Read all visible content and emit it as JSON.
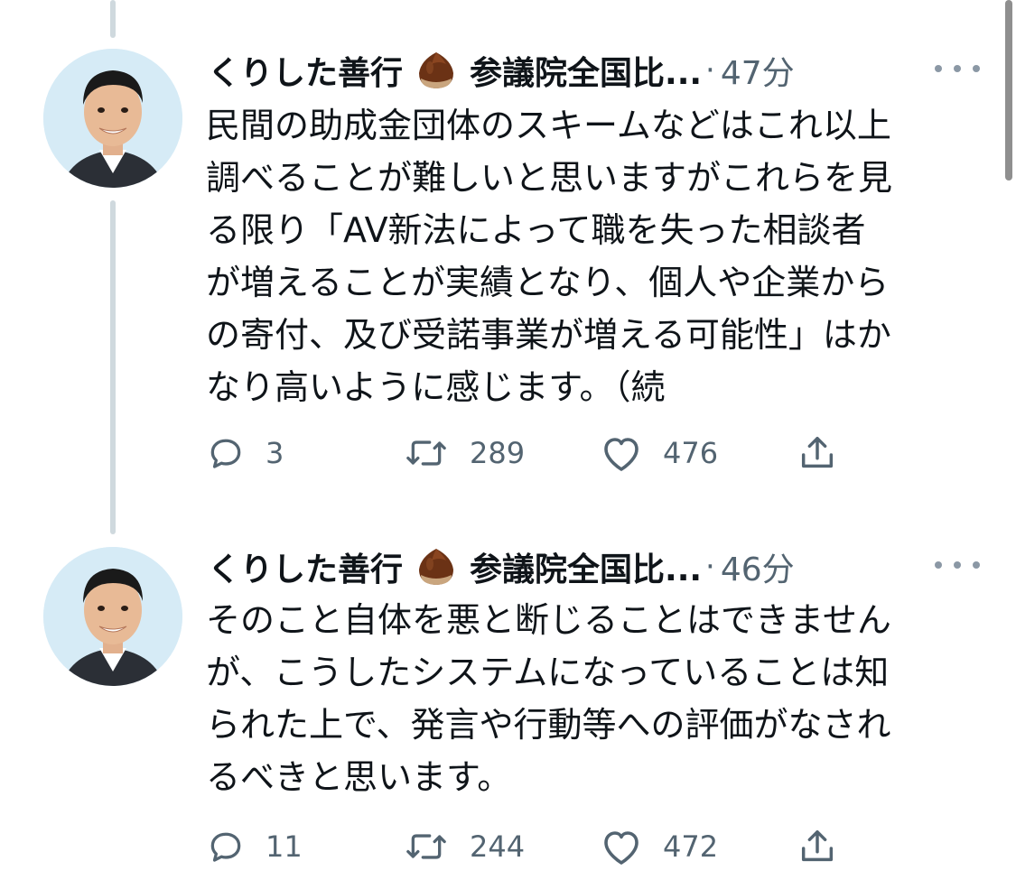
{
  "tweets": [
    {
      "name": "くりした善行",
      "title": "参議院全国比...",
      "separator": "·",
      "time": "47分",
      "body_lines": [
        "民間の助成金団体のスキームなどはこれ以上",
        "調べることが難しいと思いますがこれらを見",
        "る限り「AV新法によって職を失った相談者",
        "が増えることが実績となり、個人や企業から",
        "の寄付、及び受諾事業が増える可能性」はか",
        "なり高いように感じます。（続"
      ],
      "replies": "3",
      "retweets": "289",
      "likes": "476"
    },
    {
      "name": "くりした善行",
      "title": "参議院全国比...",
      "separator": "·",
      "time": "46分",
      "body_lines": [
        "そのこと自体を悪と断じることはできません",
        "が、こうしたシステムになっていることは知",
        "られた上で、発言や行動等への評価がなされ",
        "るべきと思います。"
      ],
      "replies": "11",
      "retweets": "244",
      "likes": "472"
    }
  ],
  "icons": {
    "reply": "reply-icon",
    "retweet": "retweet-icon",
    "like": "heart-icon",
    "share": "share-icon",
    "more": "more-icon",
    "emoji": "chestnut-emoji"
  },
  "colors": {
    "text": "#0f1419",
    "secondary": "#536471",
    "thread_line": "#cfd9de"
  }
}
